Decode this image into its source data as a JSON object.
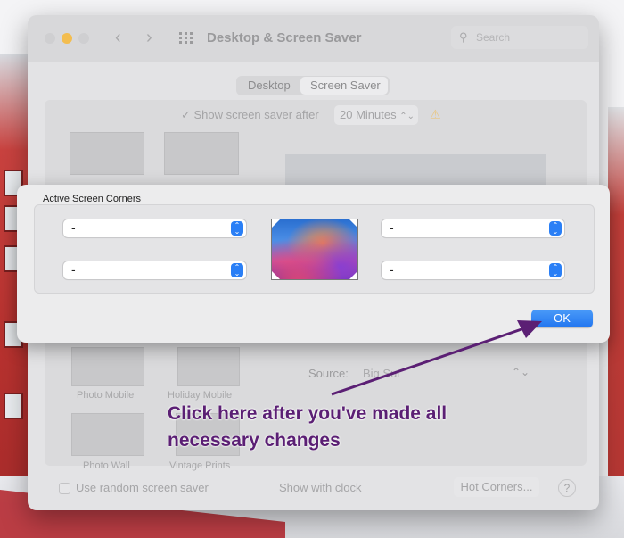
{
  "window": {
    "title": "Desktop & Screen Saver",
    "search_placeholder": "Search"
  },
  "tabs": [
    {
      "label": "Desktop",
      "active": false
    },
    {
      "label": "Screen Saver",
      "active": true
    }
  ],
  "screen_saver": {
    "show_after_label": "Show screen saver after",
    "show_after_checked": true,
    "minutes_value": "20 Minutes",
    "thumbnails": [
      {
        "label": "Photo Mobile"
      },
      {
        "label": "Holiday Mobile"
      },
      {
        "label": "Photo Wall"
      },
      {
        "label": "Vintage Prints"
      }
    ],
    "source_label": "Source:",
    "source_value": "Big Sur",
    "use_random_label": "Use random screen saver",
    "show_clock_label": "Show with clock",
    "hot_corners_label": "Hot Corners...",
    "help_label": "?"
  },
  "sheet": {
    "title": "Active Screen Corners",
    "corners": {
      "top_left": "-",
      "top_right": "-",
      "bottom_left": "-",
      "bottom_right": "-"
    },
    "ok_label": "OK"
  },
  "annotation": {
    "text_line1": "Click here after you've made all",
    "text_line2": "necessary changes",
    "color": "#5b1f74"
  },
  "colors": {
    "accent_blue": "#2a7ff6",
    "warning": "#e9c680"
  }
}
